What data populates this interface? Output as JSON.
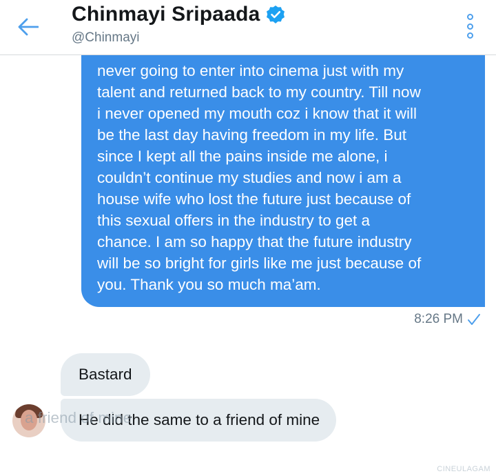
{
  "header": {
    "name": "Chinmayi Sripaada",
    "handle": "@Chinmayi",
    "verified": true,
    "accent_color": "#1da1f2"
  },
  "messages": {
    "sent": {
      "text": "never going to enter into cinema just with my\ntalent and returned back to my country. Till now\ni never opened my mouth coz i know that it will\nbe the last day having freedom in my life. But\nsince I kept all the pains inside me alone, i\ncouldn’t continue my studies and now i am a\nhouse wife who lost the future just because of\nthis sexual offers in the industry to get a\nchance. I am so happy that the future industry\nwill be so bright for girls like me just because of\nyou. Thank you so much ma’am.",
      "time": "8:26 PM",
      "bubble_color": "#3a8ee8"
    },
    "received": [
      {
        "text": "Bastard"
      },
      {
        "text": "He did the same to a friend of mine"
      }
    ],
    "ghost_text": "a friend of mine"
  },
  "watermark": "CINEULAGAM",
  "icons": {
    "back": "back-arrow-icon",
    "verified": "verified-badge-icon",
    "more": "more-options-icon",
    "read": "read-check-icon"
  }
}
